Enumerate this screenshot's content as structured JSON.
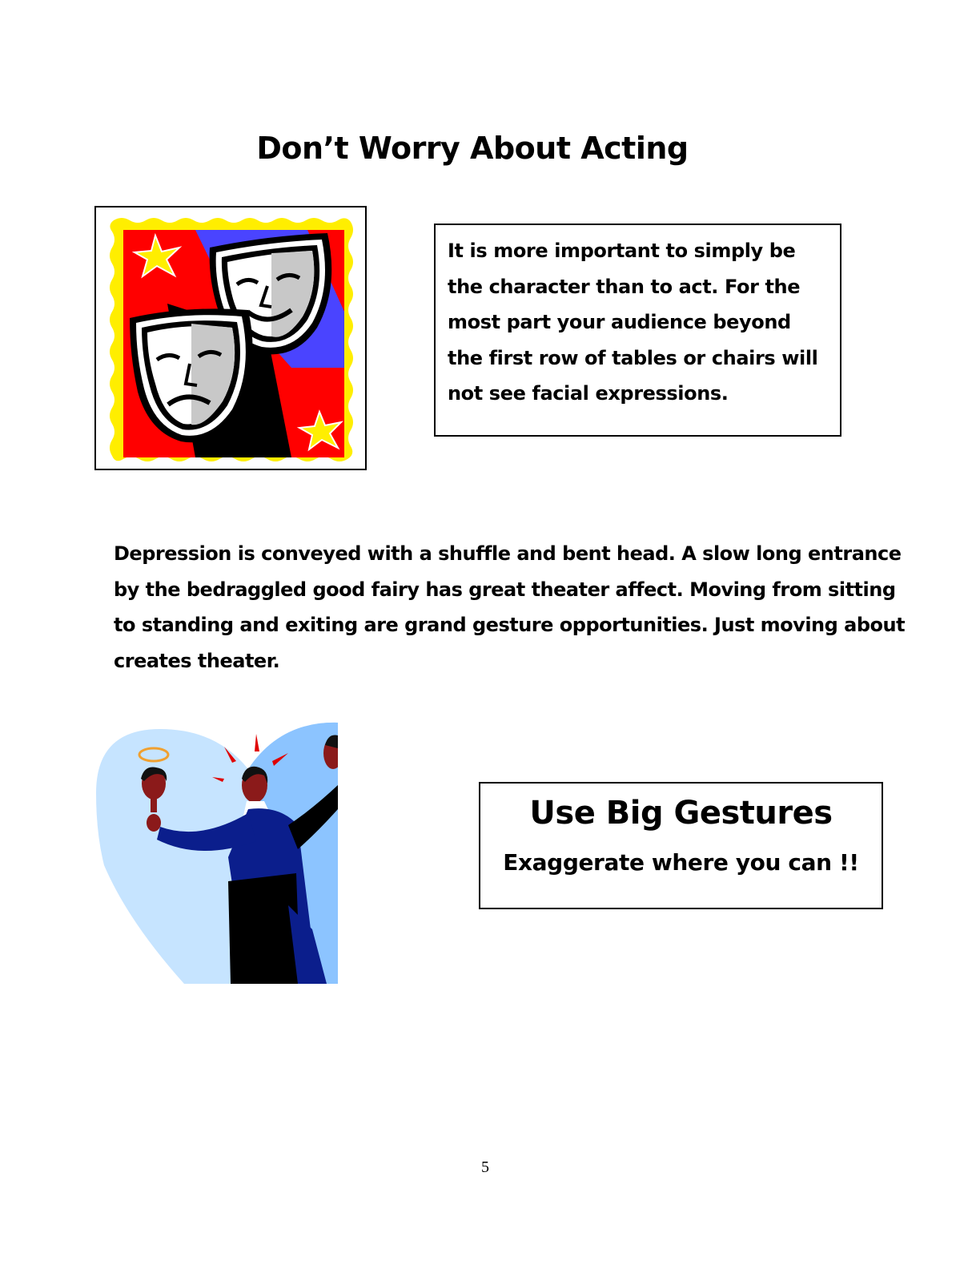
{
  "page": {
    "title": "Don’t Worry About Acting",
    "page_number": "5"
  },
  "masks_image": {
    "icon": "theater-masks-icon"
  },
  "info_box": {
    "lines": [
      "It is more important to simply be",
      "the character than to act. For the",
      "most part your audience beyond",
      "the first row of tables or chairs will",
      "not see facial expressions."
    ]
  },
  "body": {
    "lines": [
      "Depression is conveyed with a shuffle and bent head. A slow long entrance",
      "by the bedraggled good fairy has great theater affect. Moving from sitting",
      "to standing and exiting are grand gesture opportunities. Just moving about",
      "creates theater."
    ]
  },
  "gesture_image": {
    "icon": "gesturing-figures-icon"
  },
  "gestures_box": {
    "title": "Use Big Gestures",
    "subtitle": "Exaggerate where you can !!"
  }
}
